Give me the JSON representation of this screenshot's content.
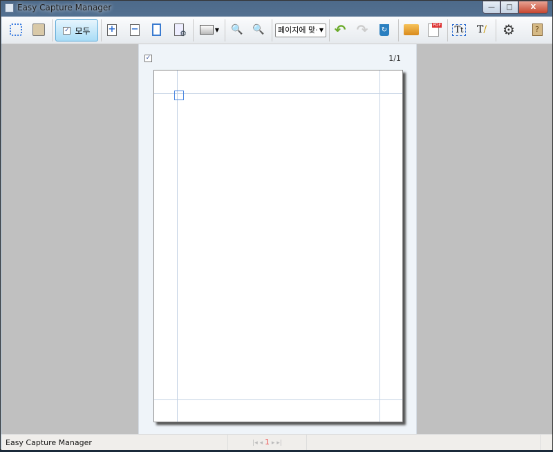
{
  "window": {
    "title": "Easy Capture Manager",
    "minimize": "—",
    "maximize": "□",
    "close": "X"
  },
  "toolbar": {
    "select_all_label": "모두",
    "zoom_select_value": "페이지에 맞·",
    "icons": [
      "capture-region-icon",
      "save-icon",
      "add-page-icon",
      "remove-page-icon",
      "blank-page-icon",
      "page-settings-icon",
      "print-icon",
      "zoom-in-icon",
      "zoom-out-icon",
      "undo-icon",
      "redo-icon",
      "recycle-icon",
      "open-folder-icon",
      "pdf-icon",
      "text-box-icon",
      "text-edit-icon",
      "settings-icon",
      "help-icon"
    ]
  },
  "page": {
    "number": "1/1",
    "checked": true
  },
  "status": {
    "text": "Easy Capture Manager",
    "current_page": "1",
    "first": "|◂",
    "prev": "◂",
    "next": "▸",
    "last": "▸|"
  }
}
